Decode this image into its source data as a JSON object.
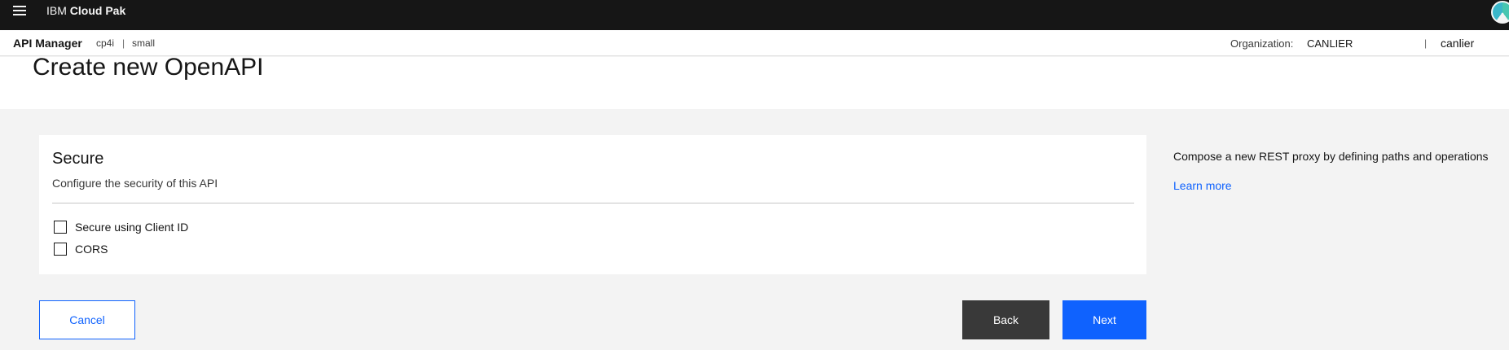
{
  "topbar": {
    "brand_prefix": "IBM",
    "brand_name": "Cloud Pak"
  },
  "subbar": {
    "product": "API Manager",
    "crumbs": [
      "cp4i",
      "|",
      "small"
    ],
    "org_label": "Organization:",
    "org_value": "CANLIER",
    "separator": "|",
    "user": "canlier"
  },
  "page": {
    "title": "Create new OpenAPI"
  },
  "secure_card": {
    "title": "Secure",
    "description": "Configure the security of this API",
    "options": [
      {
        "label": "Secure using Client ID",
        "checked": false
      },
      {
        "label": "CORS",
        "checked": false
      }
    ]
  },
  "side_panel": {
    "text": "Compose a new REST proxy by defining paths and operations",
    "link": "Learn more"
  },
  "footer": {
    "cancel_label": "Cancel",
    "back_label": "Back",
    "next_label": "Next"
  },
  "colors": {
    "topbar_bg": "#161616",
    "primary": "#0f62fe",
    "secondary_btn": "#393939",
    "page_bg": "#f3f3f3"
  }
}
